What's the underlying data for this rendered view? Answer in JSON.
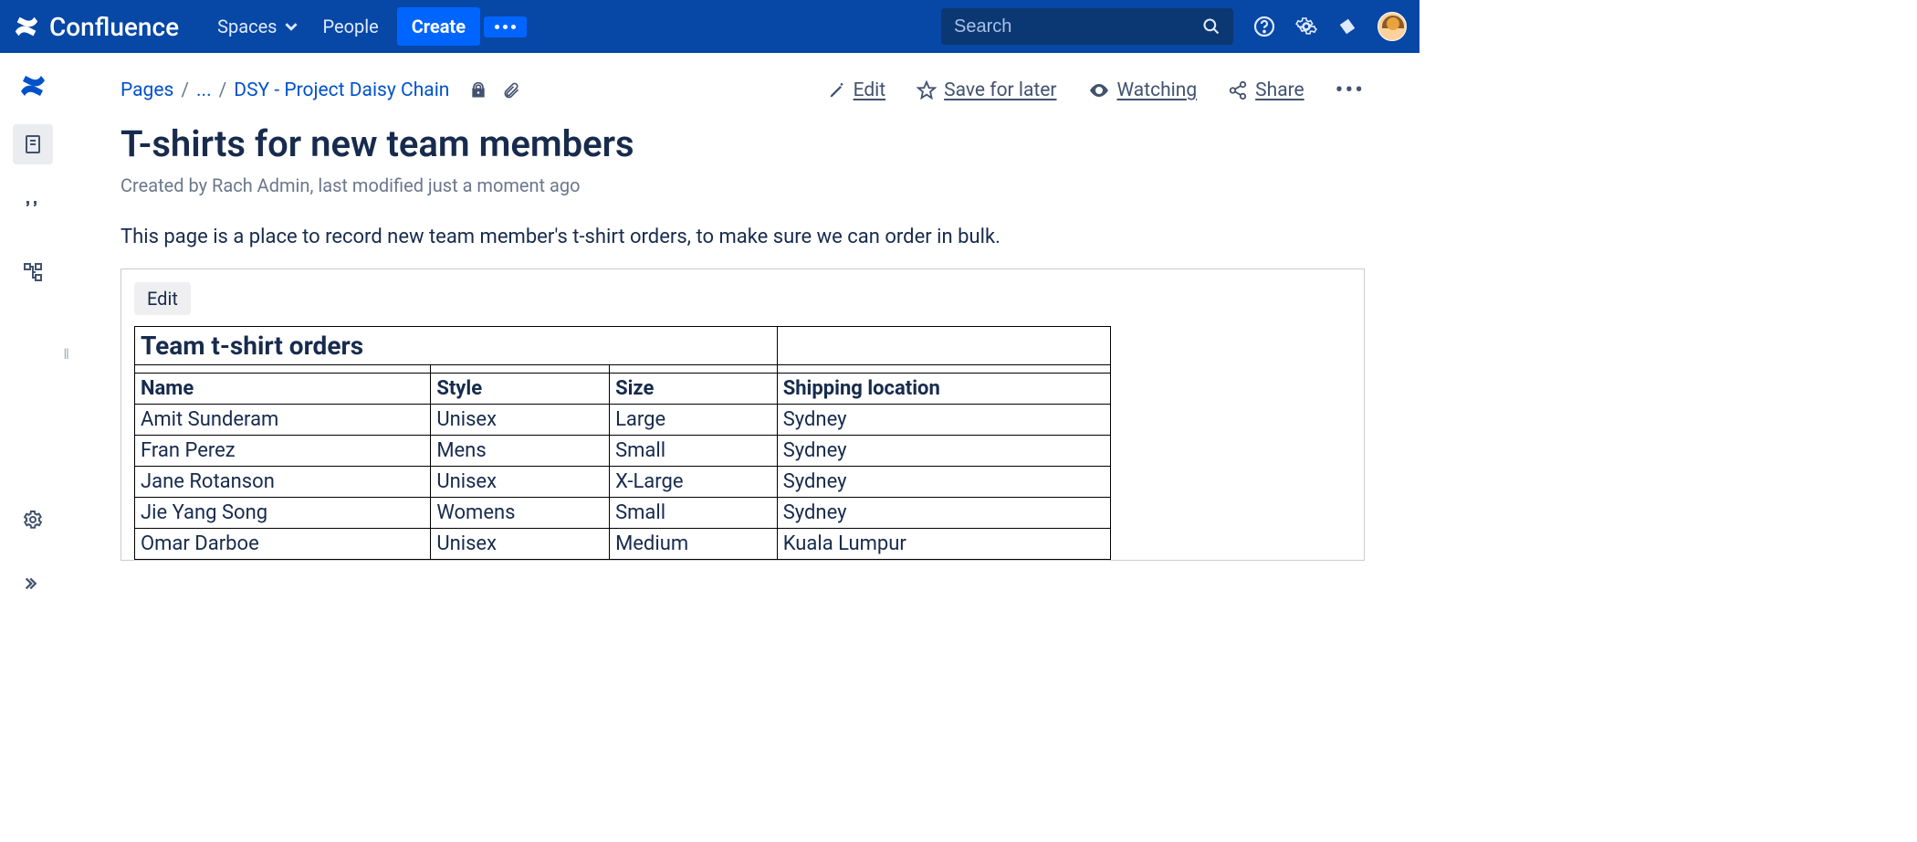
{
  "brand": "Confluence",
  "nav": {
    "spaces": "Spaces",
    "people": "People",
    "create": "Create",
    "search_placeholder": "Search"
  },
  "breadcrumbs": {
    "pages": "Pages",
    "ellipsis": "...",
    "parent": "DSY - Project Daisy Chain"
  },
  "page_actions": {
    "edit": "Edit",
    "save_for_later": "Save for later",
    "watching": "Watching",
    "share": "Share"
  },
  "page": {
    "title": "T-shirts for new team members",
    "byline": "Created by Rach Admin, last modified just a moment ago",
    "intro": "This page is a place to record new team member's t-shirt orders, to make sure we can order in bulk."
  },
  "panel": {
    "edit_label": "Edit",
    "table_title": "Team t-shirt orders"
  },
  "table": {
    "headers": [
      "Name",
      "Style",
      "Size",
      "Shipping location"
    ],
    "rows": [
      [
        "Amit Sunderam",
        "Unisex",
        "Large",
        "Sydney"
      ],
      [
        "Fran Perez",
        "Mens",
        "Small",
        "Sydney"
      ],
      [
        "Jane Rotanson",
        "Unisex",
        "X-Large",
        "Sydney"
      ],
      [
        "Jie Yang Song",
        "Womens",
        "Small",
        "Sydney"
      ],
      [
        "Omar Darboe",
        "Unisex",
        "Medium",
        "Kuala Lumpur"
      ]
    ]
  }
}
